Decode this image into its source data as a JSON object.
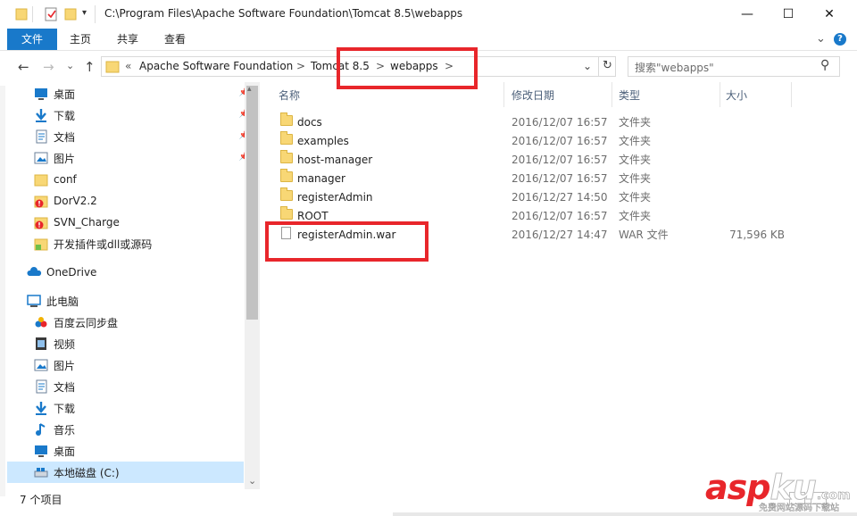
{
  "window": {
    "title": "C:\\Program Files\\Apache Software Foundation\\Tomcat 8.5\\webapps",
    "min_glyph": "—",
    "max_glyph": "☐",
    "close_glyph": "✕"
  },
  "ribbon": {
    "tabs": [
      "文件",
      "主页",
      "共享",
      "查看"
    ],
    "expand_glyph": "⌄",
    "help_glyph": "?"
  },
  "nav": {
    "back": "←",
    "forward": "→",
    "history": "⌄",
    "up": "↑",
    "breadcrumb": [
      "«",
      "Apache Software Foundation",
      ">",
      "Tomcat 8.5",
      ">",
      "webapps",
      ">"
    ],
    "dropdown": "⌄",
    "refresh": "↻",
    "search_placeholder": "搜索\"webapps\"",
    "search_icon": "⚲"
  },
  "sidebar": {
    "quick_access": [
      {
        "label": "桌面",
        "icon": "desktop-icon",
        "pinned": true
      },
      {
        "label": "下载",
        "icon": "download-icon",
        "pinned": true
      },
      {
        "label": "文档",
        "icon": "document-icon",
        "pinned": true
      },
      {
        "label": "图片",
        "icon": "picture-icon",
        "pinned": true
      },
      {
        "label": "conf",
        "icon": "folder-icon",
        "pinned": false
      },
      {
        "label": "DorV2.2",
        "icon": "folder-warning-icon",
        "pinned": false
      },
      {
        "label": "SVN_Charge",
        "icon": "folder-warning-icon",
        "pinned": false
      },
      {
        "label": "开发插件或dll或源码",
        "icon": "folder-ok-icon",
        "pinned": false
      }
    ],
    "onedrive": "OneDrive",
    "this_pc": "此电脑",
    "pc_items": [
      {
        "label": "百度云同步盘",
        "icon": "baidu-sync-icon"
      },
      {
        "label": "视频",
        "icon": "video-icon"
      },
      {
        "label": "图片",
        "icon": "picture-icon"
      },
      {
        "label": "文档",
        "icon": "document-icon"
      },
      {
        "label": "下载",
        "icon": "download-icon"
      },
      {
        "label": "音乐",
        "icon": "music-icon"
      },
      {
        "label": "桌面",
        "icon": "desktop-icon"
      },
      {
        "label": "本地磁盘 (C:)",
        "icon": "drive-icon",
        "selected": true
      }
    ],
    "scroll_down": "⌄"
  },
  "columns": {
    "name": "名称",
    "date": "修改日期",
    "type": "类型",
    "size": "大小"
  },
  "files": [
    {
      "name": "docs",
      "date": "2016/12/07 16:57",
      "type": "文件夹",
      "size": "",
      "kind": "folder"
    },
    {
      "name": "examples",
      "date": "2016/12/07 16:57",
      "type": "文件夹",
      "size": "",
      "kind": "folder"
    },
    {
      "name": "host-manager",
      "date": "2016/12/07 16:57",
      "type": "文件夹",
      "size": "",
      "kind": "folder"
    },
    {
      "name": "manager",
      "date": "2016/12/07 16:57",
      "type": "文件夹",
      "size": "",
      "kind": "folder"
    },
    {
      "name": "registerAdmin",
      "date": "2016/12/27 14:50",
      "type": "文件夹",
      "size": "",
      "kind": "folder"
    },
    {
      "name": "ROOT",
      "date": "2016/12/07 16:57",
      "type": "文件夹",
      "size": "",
      "kind": "folder"
    },
    {
      "name": "registerAdmin.war",
      "date": "2016/12/27 14:47",
      "type": "WAR 文件",
      "size": "71,596 KB",
      "kind": "file"
    }
  ],
  "status": {
    "count": "7 个项目"
  },
  "watermark": {
    "brand": "asp",
    "brand_tail": "ku",
    "domain": ".com",
    "tagline": "免费网站源码下载站"
  },
  "colors": {
    "accent": "#1979ca",
    "highlight_box": "#e8262b",
    "selection": "#cce8ff"
  }
}
